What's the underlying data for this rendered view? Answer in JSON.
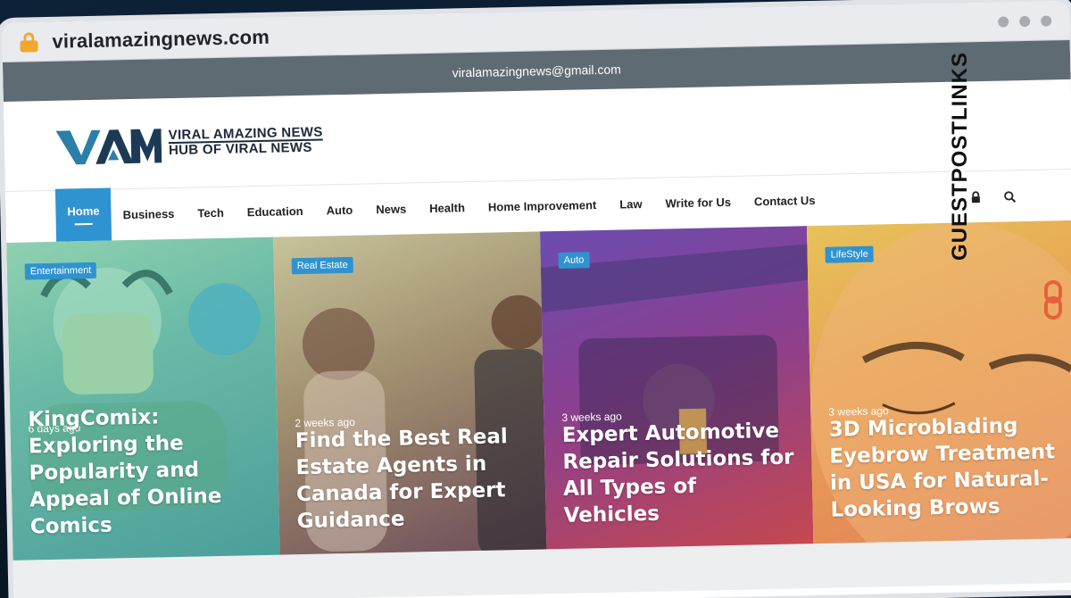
{
  "browser": {
    "url": "viralamazingnews.com",
    "lock_icon": "lock-icon"
  },
  "topbar": {
    "email": "viralamazingnews@gmail.com"
  },
  "logo": {
    "mark": "VAM",
    "line1": "VIRAL AMAZING NEWS",
    "line2": "HUB OF VIRAL NEWS"
  },
  "nav": {
    "items": [
      {
        "label": "Home",
        "active": true
      },
      {
        "label": "Business"
      },
      {
        "label": "Tech"
      },
      {
        "label": "Education"
      },
      {
        "label": "Auto"
      },
      {
        "label": "News"
      },
      {
        "label": "Health"
      },
      {
        "label": "Home Improvement"
      },
      {
        "label": "Law"
      },
      {
        "label": "Write for Us"
      },
      {
        "label": "Contact Us"
      }
    ],
    "right_icons": [
      "lock-icon",
      "search-icon"
    ]
  },
  "cards": [
    {
      "category": "Entertainment",
      "time": "6 days ago",
      "title": "KingComix: Exploring the Popularity and Appeal of Online Comics"
    },
    {
      "category": "Real Estate",
      "time": "2 weeks ago",
      "title": "Find the Best Real Estate Agents in Canada for Expert Guidance"
    },
    {
      "category": "Auto",
      "time": "3 weeks ago",
      "title": "Expert Automotive Repair Solutions for All Types of Vehicles"
    },
    {
      "category": "LifeStyle",
      "time": "3 weeks ago",
      "title": "3D Microblading Eyebrow Treatment in USA for Natural-Looking Brows"
    }
  ],
  "side_brand": {
    "text": "GUESTPOSTLINKS"
  },
  "colors": {
    "accent": "#2f93d1",
    "topbar": "#5f6b73",
    "lock": "#f3a72f"
  }
}
